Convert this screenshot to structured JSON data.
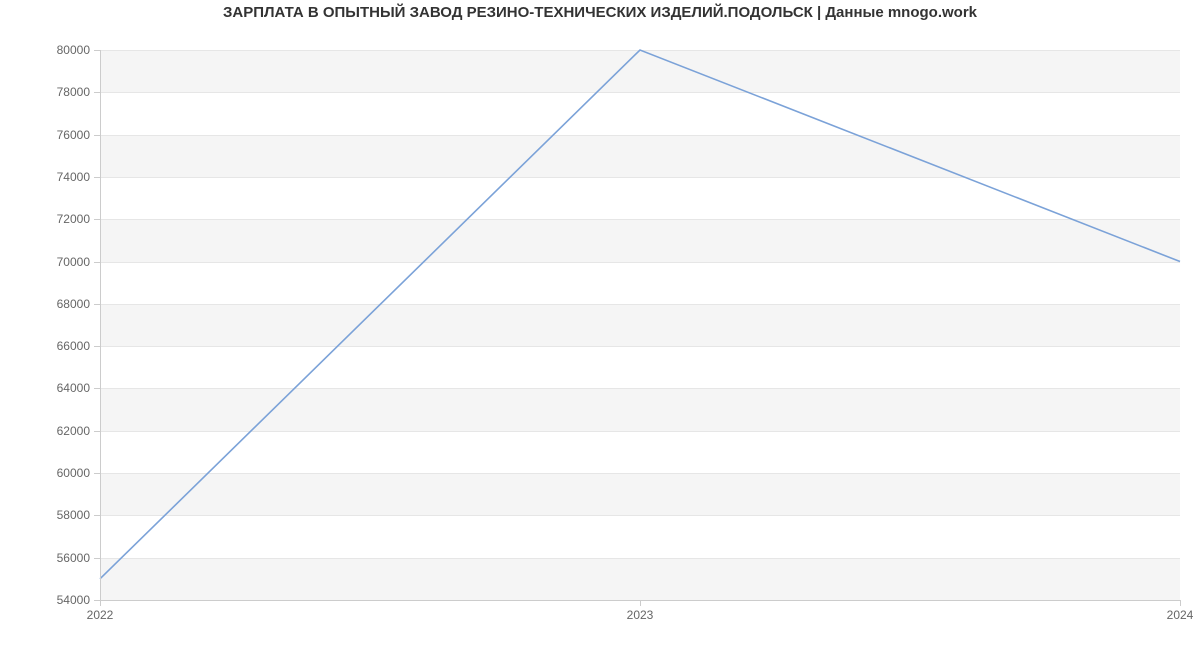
{
  "chart_data": {
    "type": "line",
    "title": "ЗАРПЛАТА В  ОПЫТНЫЙ ЗАВОД РЕЗИНО-ТЕХНИЧЕСКИХ ИЗДЕЛИЙ.ПОДОЛЬСК | Данные mnogo.work",
    "x": [
      2022,
      2023,
      2024
    ],
    "values": [
      55000,
      80000,
      70000
    ],
    "xlabel": "",
    "ylabel": "",
    "xlim": [
      2022,
      2024
    ],
    "ylim": [
      54000,
      80000
    ],
    "x_ticks": [
      2022,
      2023,
      2024
    ],
    "y_ticks": [
      54000,
      56000,
      58000,
      60000,
      62000,
      64000,
      66000,
      68000,
      70000,
      72000,
      74000,
      76000,
      78000,
      80000
    ],
    "line_color": "#7ba2d8",
    "band_color": "#f5f5f5",
    "grid": true
  }
}
